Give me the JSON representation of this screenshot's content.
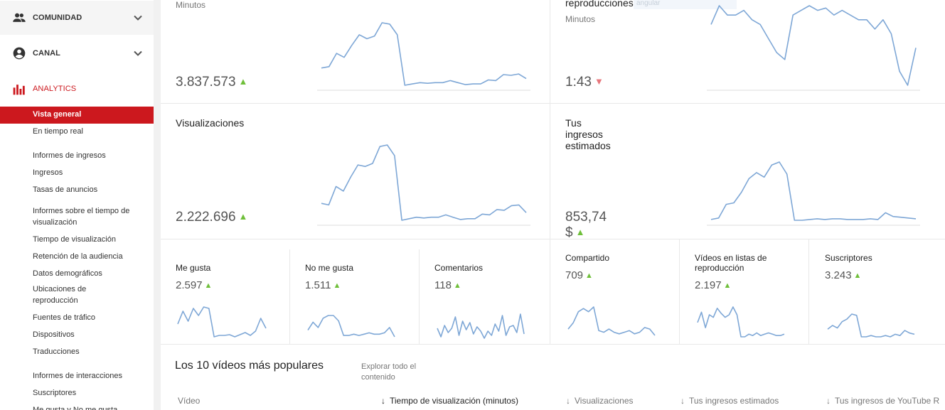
{
  "sidebar": {
    "sections": [
      {
        "label": "COMUNIDAD",
        "icon": "people-icon"
      },
      {
        "label": "CANAL",
        "icon": "account-circle-icon"
      },
      {
        "label": "ANALYTICS",
        "icon": "bar-chart-icon"
      }
    ],
    "items": [
      {
        "label": "Vista general",
        "active": true
      },
      {
        "label": "En tiempo real"
      },
      {
        "label": "Informes de ingresos",
        "heading": true
      },
      {
        "label": "Ingresos"
      },
      {
        "label": "Tasas de anuncios"
      },
      {
        "label": "Informes sobre el tiempo de visualización",
        "heading": true
      },
      {
        "label": "Tiempo de visualización"
      },
      {
        "label": "Retención de la audiencia"
      },
      {
        "label": "Datos demográficos"
      },
      {
        "label": "Ubicaciones de reproducción"
      },
      {
        "label": "Fuentes de tráfico"
      },
      {
        "label": "Dispositivos"
      },
      {
        "label": "Traducciones"
      },
      {
        "label": "Informes de interacciones",
        "heading": true
      },
      {
        "label": "Suscriptores"
      },
      {
        "label": "Me gusta y No me gusta"
      }
    ]
  },
  "cards": {
    "watch_time": {
      "subtitle": "Minutos",
      "value": "3.837.573",
      "trend": "up"
    },
    "avg_duration": {
      "title": "reproducciones",
      "subtitle": "Minutos",
      "value": "1:43",
      "trend": "down",
      "tooltip_fragment": "angular"
    },
    "views": {
      "title": "Visualizaciones",
      "value": "2.222.696",
      "trend": "up"
    },
    "revenue": {
      "title": "Tus ingresos estimados",
      "value": "853,74 $",
      "trend": "up"
    }
  },
  "small_cards": [
    {
      "title": "Me gusta",
      "value": "2.597",
      "trend": "up"
    },
    {
      "title": "No me gusta",
      "value": "1.511",
      "trend": "up"
    },
    {
      "title": "Comentarios",
      "value": "118",
      "trend": "up"
    },
    {
      "title": "Compartido",
      "value": "709",
      "trend": "up"
    },
    {
      "title": "Vídeos en listas de reproducción",
      "value": "2.197",
      "trend": "up"
    },
    {
      "title": "Suscriptores",
      "value": "3.243",
      "trend": "up"
    }
  ],
  "trend_glyphs": {
    "up": "▲",
    "down": "▼"
  },
  "popular": {
    "title": "Los 10 vídeos más populares",
    "explore_link": "Explorar todo el contenido",
    "columns": [
      {
        "label": "Vídeo",
        "sorted": false,
        "arrow": ""
      },
      {
        "label": "Tiempo de visualización (minutos)",
        "sorted": true,
        "arrow": "↓"
      },
      {
        "label": "Visualizaciones",
        "sorted": false,
        "arrow": "↓"
      },
      {
        "label": "Tus ingresos estimados",
        "sorted": false,
        "arrow": "↓"
      },
      {
        "label": "Tus ingresos de YouTube R",
        "sorted": false,
        "arrow": "↓"
      }
    ]
  },
  "sparklines": {
    "watch_time": [
      30,
      32,
      52,
      46,
      64,
      80,
      74,
      78,
      98,
      96,
      80,
      4,
      6,
      8,
      7,
      8,
      8,
      11,
      8,
      5,
      6,
      6,
      12,
      11,
      20,
      19,
      21,
      14
    ],
    "avg_duration": [
      78,
      86,
      82,
      82,
      84,
      80,
      78,
      72,
      66,
      63,
      82,
      84,
      86,
      84,
      85,
      82,
      84,
      82,
      80,
      80,
      76,
      80,
      74,
      58,
      52,
      68
    ],
    "views": [
      30,
      28,
      52,
      46,
      64,
      80,
      78,
      82,
      104,
      106,
      92,
      8,
      10,
      12,
      11,
      12,
      12,
      15,
      12,
      9,
      10,
      10,
      16,
      15,
      22,
      21,
      27,
      28,
      18
    ],
    "revenue": [
      6,
      8,
      26,
      28,
      42,
      60,
      68,
      62,
      78,
      82,
      66,
      5,
      5,
      6,
      7,
      6,
      7,
      7,
      6,
      6,
      6,
      7,
      6,
      15,
      10,
      9,
      8,
      7
    ],
    "likes": [
      28,
      46,
      32,
      50,
      40,
      52,
      50,
      10,
      12,
      12,
      13,
      10,
      13,
      16,
      12,
      18,
      36,
      22
    ],
    "dislikes": [
      14,
      26,
      18,
      32,
      36,
      36,
      28,
      6,
      6,
      8,
      6,
      8,
      10,
      8,
      8,
      10,
      18,
      4
    ],
    "comments": [
      18,
      6,
      22,
      12,
      18,
      34,
      8,
      28,
      16,
      26,
      10,
      20,
      14,
      4,
      14,
      8,
      24,
      14,
      36,
      8,
      20,
      22,
      12,
      38,
      10
    ],
    "shares": [
      16,
      24,
      38,
      42,
      38,
      44,
      14,
      12,
      16,
      12,
      10,
      12,
      14,
      10,
      12,
      18,
      16,
      8
    ],
    "playlists": [
      30,
      46,
      22,
      42,
      38,
      52,
      44,
      38,
      42,
      54,
      42,
      8,
      8,
      12,
      10,
      14,
      10,
      12,
      14,
      12,
      10,
      10,
      12
    ],
    "subscribers": [
      22,
      28,
      24,
      34,
      38,
      46,
      44,
      10,
      10,
      12,
      10,
      10,
      12,
      10,
      14,
      12,
      20,
      16,
      14
    ]
  }
}
